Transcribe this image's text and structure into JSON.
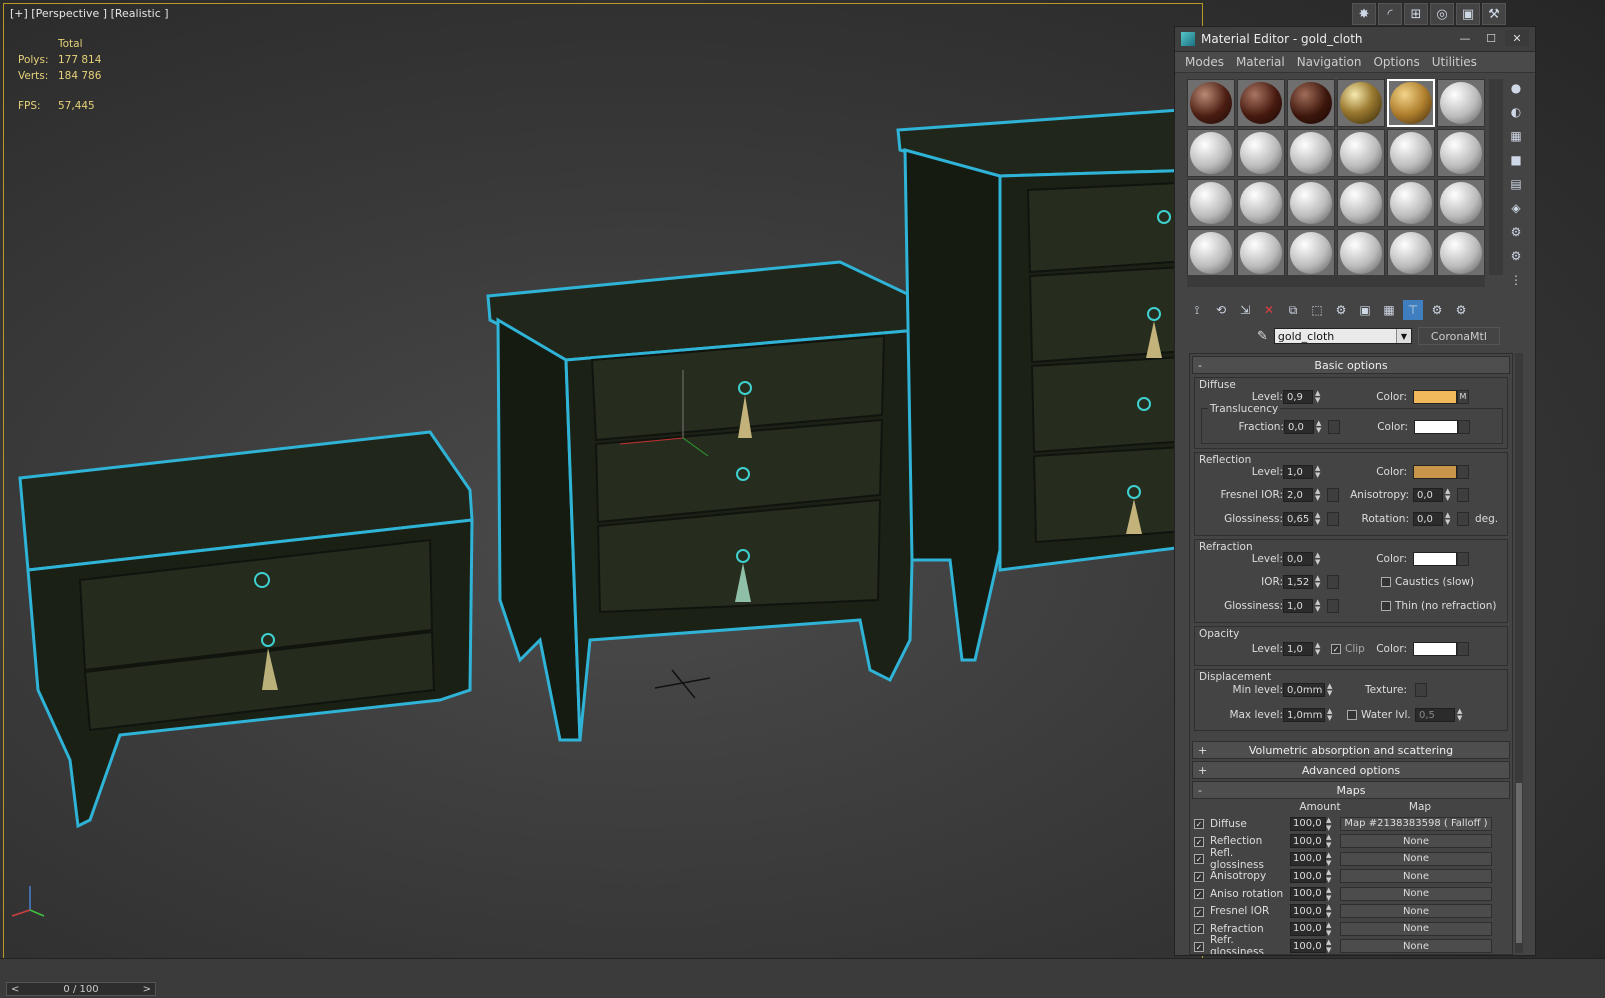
{
  "viewport": {
    "label": "[+] [Perspective ] [Realistic ]",
    "stats": {
      "total_header": "Total",
      "polys_label": "Polys:",
      "polys_value": "177 814",
      "verts_label": "Verts:",
      "verts_value": "184 786",
      "fps_label": "FPS:",
      "fps_value": "57,445"
    }
  },
  "timeline": {
    "frame": "0 / 100",
    "prev": "<",
    "next": ">"
  },
  "material_editor": {
    "title": "Material Editor - gold_cloth",
    "menu": [
      "Modes",
      "Material",
      "Navigation",
      "Options",
      "Utilities"
    ],
    "material_name": "gold_cloth",
    "material_type": "CoronaMtl",
    "basic_options": {
      "header": "Basic options",
      "diffuse": {
        "group": "Diffuse",
        "level_label": "Level:",
        "level": "0,9",
        "color_label": "Color:",
        "color": "#f2b85c",
        "map_flag": "M"
      },
      "translucency": {
        "group": "Translucency",
        "fraction_label": "Fraction:",
        "fraction": "0,0",
        "color_label": "Color:",
        "color": "#ffffff"
      },
      "reflection": {
        "group": "Reflection",
        "level_label": "Level:",
        "level": "1,0",
        "color_label": "Color:",
        "color": "#c8964a",
        "fresnel_label": "Fresnel IOR:",
        "fresnel": "2,0",
        "aniso_label": "Anisotropy:",
        "aniso": "0,0",
        "gloss_label": "Glossiness:",
        "gloss": "0,65",
        "rotation_label": "Rotation:",
        "rotation": "0,0",
        "deg": "deg."
      },
      "refraction": {
        "group": "Refraction",
        "level_label": "Level:",
        "level": "0,0",
        "color_label": "Color:",
        "color": "#ffffff",
        "ior_label": "IOR:",
        "ior": "1,52",
        "caustics": "Caustics (slow)",
        "gloss_label": "Glossiness:",
        "gloss": "1,0",
        "thin": "Thin (no refraction)"
      },
      "opacity": {
        "group": "Opacity",
        "level_label": "Level:",
        "level": "1,0",
        "clip": "Clip",
        "color_label": "Color:",
        "color": "#ffffff"
      },
      "displacement": {
        "group": "Displacement",
        "min_label": "Min level:",
        "min": "0,0mm",
        "texture_label": "Texture:",
        "max_label": "Max level:",
        "max": "1,0mm",
        "water_label": "Water lvl.",
        "water": "0,5"
      }
    },
    "rollouts": [
      {
        "sign": "+",
        "label": "Volumetric absorption and scattering"
      },
      {
        "sign": "+",
        "label": "Advanced options"
      },
      {
        "sign": "-",
        "label": "Maps"
      }
    ],
    "maps": {
      "amount_header": "Amount",
      "map_header": "Map",
      "rows": [
        {
          "name": "Diffuse",
          "amount": "100,0",
          "map": "Map #2138383598 ( Falloff )"
        },
        {
          "name": "Reflection",
          "amount": "100,0",
          "map": "None"
        },
        {
          "name": "Refl. glossiness",
          "amount": "100,0",
          "map": "None"
        },
        {
          "name": "Anisotropy",
          "amount": "100,0",
          "map": "None"
        },
        {
          "name": "Aniso rotation",
          "amount": "100,0",
          "map": "None"
        },
        {
          "name": "Fresnel IOR",
          "amount": "100,0",
          "map": "None"
        },
        {
          "name": "Refraction",
          "amount": "100,0",
          "map": "None"
        },
        {
          "name": "Refr. glossiness",
          "amount": "100,0",
          "map": "None"
        }
      ]
    }
  }
}
